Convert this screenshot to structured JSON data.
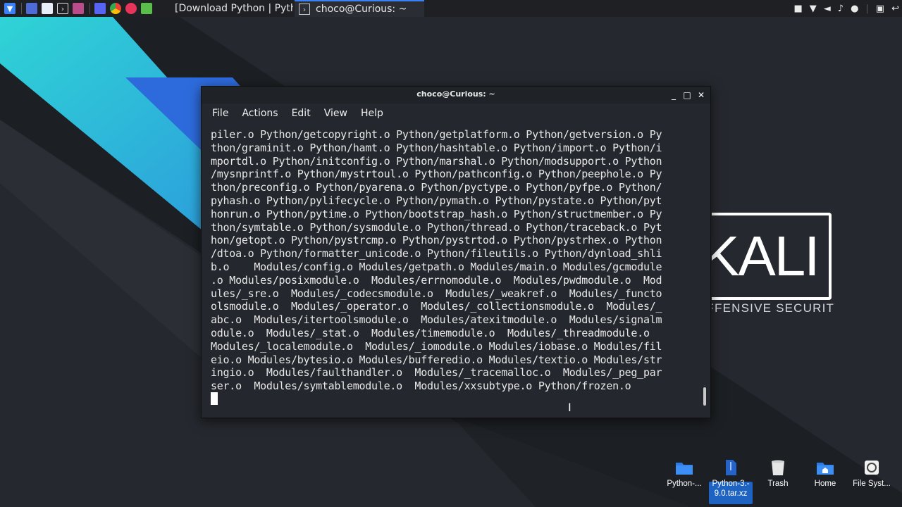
{
  "taskbar": {
    "browser_task": "[Download Python | Pyth...",
    "terminal_task": "choco@Curious: ~"
  },
  "wallpaper": {
    "logo_text": "KALI",
    "tagline": "OFFENSIVE SECURITY"
  },
  "terminal": {
    "title": "choco@Curious: ~",
    "menu": [
      "File",
      "Actions",
      "Edit",
      "View",
      "Help"
    ],
    "lines": [
      "piler.o Python/getcopyright.o Python/getplatform.o Python/getversion.o Py",
      "thon/graminit.o Python/hamt.o Python/hashtable.o Python/import.o Python/i",
      "mportdl.o Python/initconfig.o Python/marshal.o Python/modsupport.o Python",
      "/mysnprintf.o Python/mystrtoul.o Python/pathconfig.o Python/peephole.o Py",
      "thon/preconfig.o Python/pyarena.o Python/pyctype.o Python/pyfpe.o Python/",
      "pyhash.o Python/pylifecycle.o Python/pymath.o Python/pystate.o Python/pyt",
      "honrun.o Python/pytime.o Python/bootstrap_hash.o Python/structmember.o Py",
      "thon/symtable.o Python/sysmodule.o Python/thread.o Python/traceback.o Pyt",
      "hon/getopt.o Python/pystrcmp.o Python/pystrtod.o Python/pystrhex.o Python",
      "/dtoa.o Python/formatter_unicode.o Python/fileutils.o Python/dynload_shli",
      "b.o    Modules/config.o Modules/getpath.o Modules/main.o Modules/gcmodule",
      ".o Modules/posixmodule.o  Modules/errnomodule.o  Modules/pwdmodule.o  Mod",
      "ules/_sre.o  Modules/_codecsmodule.o  Modules/_weakref.o  Modules/_functo",
      "olsmodule.o  Modules/_operator.o  Modules/_collectionsmodule.o  Modules/_",
      "abc.o  Modules/itertoolsmodule.o  Modules/atexitmodule.o  Modules/signalm",
      "odule.o  Modules/_stat.o  Modules/timemodule.o  Modules/_threadmodule.o",
      "Modules/_localemodule.o  Modules/_iomodule.o Modules/iobase.o Modules/fil",
      "eio.o Modules/bytesio.o Modules/bufferedio.o Modules/textio.o Modules/str",
      "ingio.o  Modules/faulthandler.o  Modules/_tracemalloc.o  Modules/_peg_par",
      "ser.o  Modules/symtablemodule.o  Modules/xxsubtype.o Python/frozen.o"
    ]
  },
  "desktop_icons": [
    {
      "label": "Python-..."
    },
    {
      "label": "Python-3.-9.0.tar.xz",
      "line1": "Python-3.-",
      "line2": "9.0.tar.xz"
    },
    {
      "label": "Trash"
    },
    {
      "label": "Home"
    },
    {
      "label": "File Syst..."
    }
  ],
  "colors": {
    "accent_blue": "#3b82f6",
    "terminal_bg": "#24272d",
    "panel_bg": "#1e2024"
  }
}
